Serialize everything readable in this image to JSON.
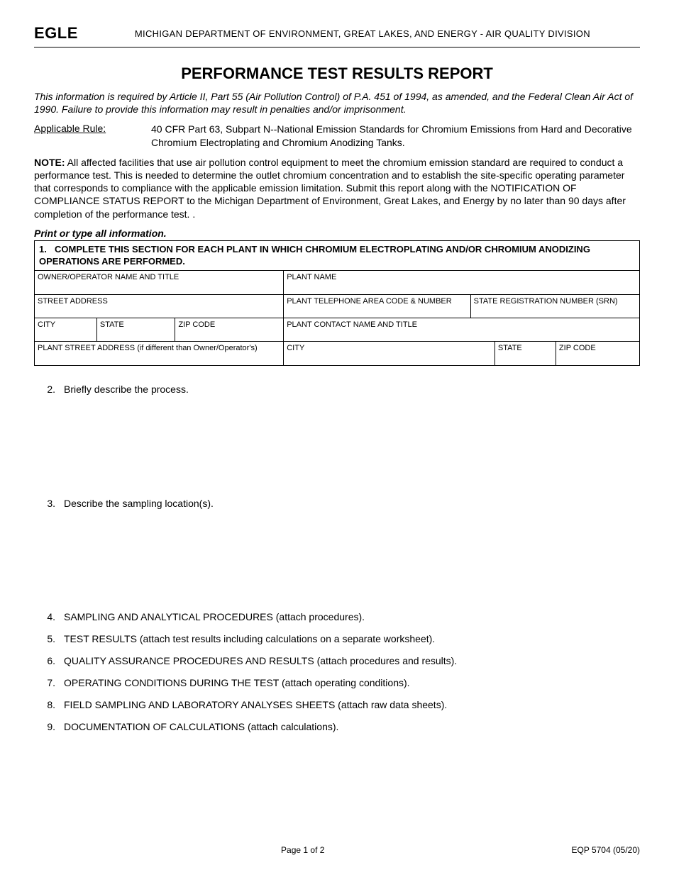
{
  "header": {
    "logo": "EGLE",
    "department": "MICHIGAN DEPARTMENT OF ENVIRONMENT, GREAT LAKES, AND ENERGY - AIR QUALITY DIVISION"
  },
  "title": "PERFORMANCE TEST RESULTS REPORT",
  "intro": "This information is required by Article II, Part 55 (Air Pollution Control) of P.A. 451 of 1994, as amended, and the Federal Clean Air Act of 1990.  Failure to provide this information may result in penalties and/or imprisonment.",
  "rule": {
    "label": "Applicable Rule:",
    "text": "40 CFR Part 63, Subpart N--National Emission Standards for Chromium Emissions from Hard and Decorative Chromium Electroplating and Chromium Anodizing Tanks."
  },
  "note": {
    "label": "NOTE:",
    "text": "  All affected facilities that use air pollution control equipment to meet the chromium emission standard are required to conduct a performance test.  This is needed to determine the outlet chromium concentration and to establish the site-specific operating parameter that corresponds to compliance with the applicable emission limitation.  Submit this report along with the NOTIFICATION OF COMPLIANCE STATUS REPORT to the Michigan Department of Environment, Great Lakes, and Energy by no later than 90 days after completion of the performance test. ."
  },
  "print_instruction": "Print or type all information.",
  "section1": {
    "number": "1.",
    "heading": "COMPLETE THIS SECTION FOR EACH PLANT IN WHICH CHROMIUM ELECTROPLATING AND/OR CHROMIUM ANODIZING OPERATIONS ARE PERFORMED.",
    "fields": {
      "owner_operator": "OWNER/OPERATOR NAME AND TITLE",
      "plant_name": "PLANT NAME",
      "street_address": "STREET ADDRESS",
      "plant_phone": "PLANT TELEPHONE AREA CODE & NUMBER",
      "srn": "STATE REGISTRATION NUMBER (SRN)",
      "city": "CITY",
      "state": "STATE",
      "zip": "ZIP CODE",
      "plant_contact": "PLANT CONTACT NAME AND TITLE",
      "plant_street": "PLANT STREET ADDRESS (if different than Owner/Operator's)",
      "city2": "CITY",
      "state2": "STATE",
      "zip2": "ZIP CODE"
    }
  },
  "questions": [
    {
      "n": "2.",
      "t": "Briefly describe the process."
    },
    {
      "n": "3.",
      "t": "Describe the sampling location(s)."
    },
    {
      "n": "4.",
      "t": "SAMPLING AND ANALYTICAL PROCEDURES (attach procedures)."
    },
    {
      "n": "5.",
      "t": "TEST RESULTS (attach test results including calculations on a separate worksheet)."
    },
    {
      "n": "6.",
      "t": "QUALITY ASSURANCE PROCEDURES AND RESULTS (attach procedures and results)."
    },
    {
      "n": "7.",
      "t": "OPERATING CONDITIONS DURING THE TEST (attach operating conditions)."
    },
    {
      "n": "8.",
      "t": "FIELD SAMPLING AND LABORATORY ANALYSES SHEETS (attach raw data sheets)."
    },
    {
      "n": "9.",
      "t": "DOCUMENTATION OF CALCULATIONS (attach calculations)."
    }
  ],
  "footer": {
    "page": "Page 1 of 2",
    "form_id": "EQP 5704 (05/20)"
  }
}
